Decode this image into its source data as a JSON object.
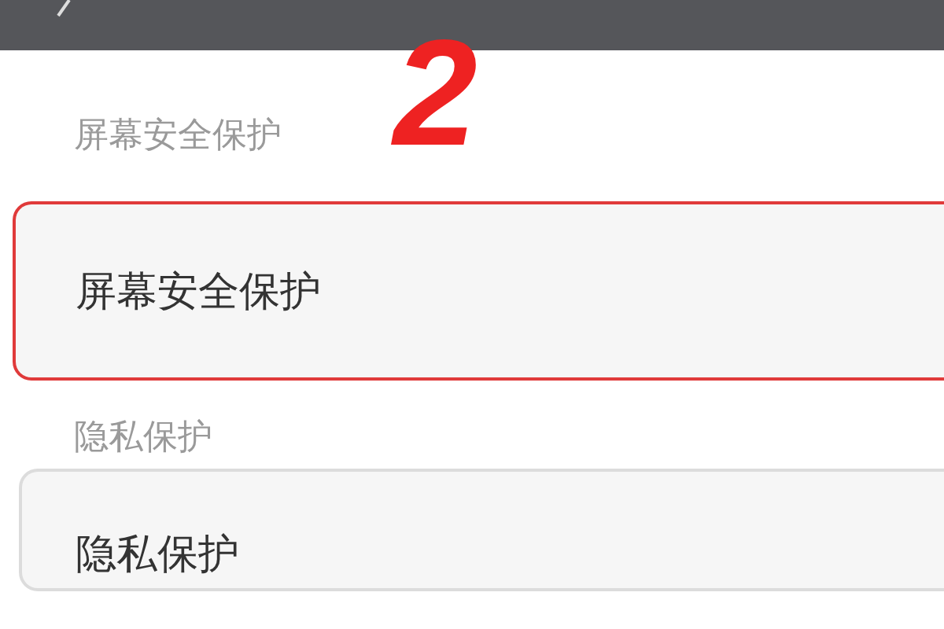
{
  "annotation": {
    "text": "2"
  },
  "sections": [
    {
      "header": "屏幕安全保护",
      "item": {
        "label": "屏幕安全保护",
        "highlighted": true
      }
    },
    {
      "header": "隐私保护",
      "item": {
        "label": "隐私保护",
        "highlighted": false
      }
    }
  ]
}
